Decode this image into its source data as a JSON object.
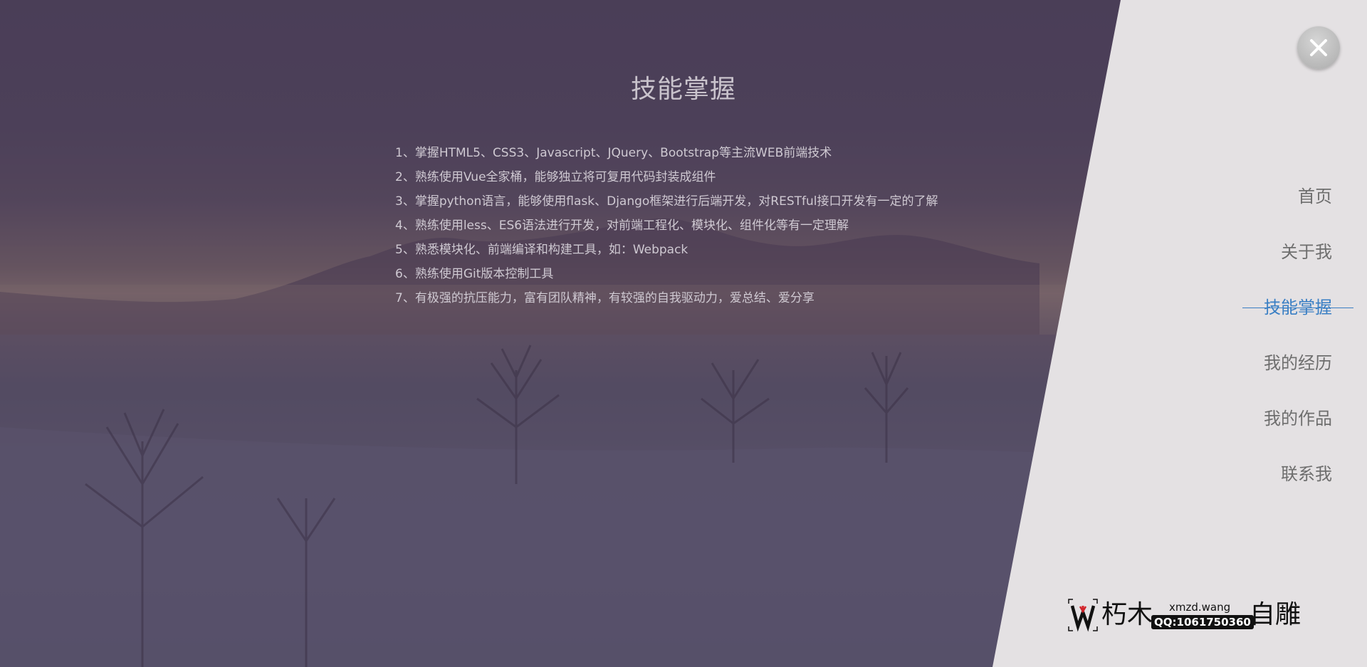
{
  "section": {
    "title": "技能掌握",
    "skills": [
      "1、掌握HTML5、CSS3、Javascript、JQuery、Bootstrap等主流WEB前端技术",
      "2、熟练使用Vue全家桶，能够独立将可复用代码封装成组件",
      "3、掌握python语言，能够使用flask、Django框架进行后端开发，对RESTful接口开发有一定的了解",
      "4、熟练使用less、ES6语法进行开发，对前端工程化、模块化、组件化等有一定理解",
      "5、熟悉模块化、前端编译和构建工具，如：Webpack",
      "6、熟练使用Git版本控制工具",
      "7、有极强的抗压能力，富有团队精神，有较强的自我驱动力，爱总结、爱分享"
    ]
  },
  "nav": {
    "items": [
      {
        "label": "首页",
        "active": false
      },
      {
        "label": "关于我",
        "active": false
      },
      {
        "label": "技能掌握",
        "active": true
      },
      {
        "label": "我的经历",
        "active": false
      },
      {
        "label": "我的作品",
        "active": false
      },
      {
        "label": "联系我",
        "active": false
      }
    ]
  },
  "close_icon": "close-icon",
  "logo": {
    "text1": "朽木",
    "domain": "xmzd.wang",
    "qq": "QQ:1061750360",
    "text2": "自雕"
  },
  "colors": {
    "accent": "#3a7fc4",
    "panel": "#e4e1e3",
    "nav_text": "#6e6e6e"
  }
}
